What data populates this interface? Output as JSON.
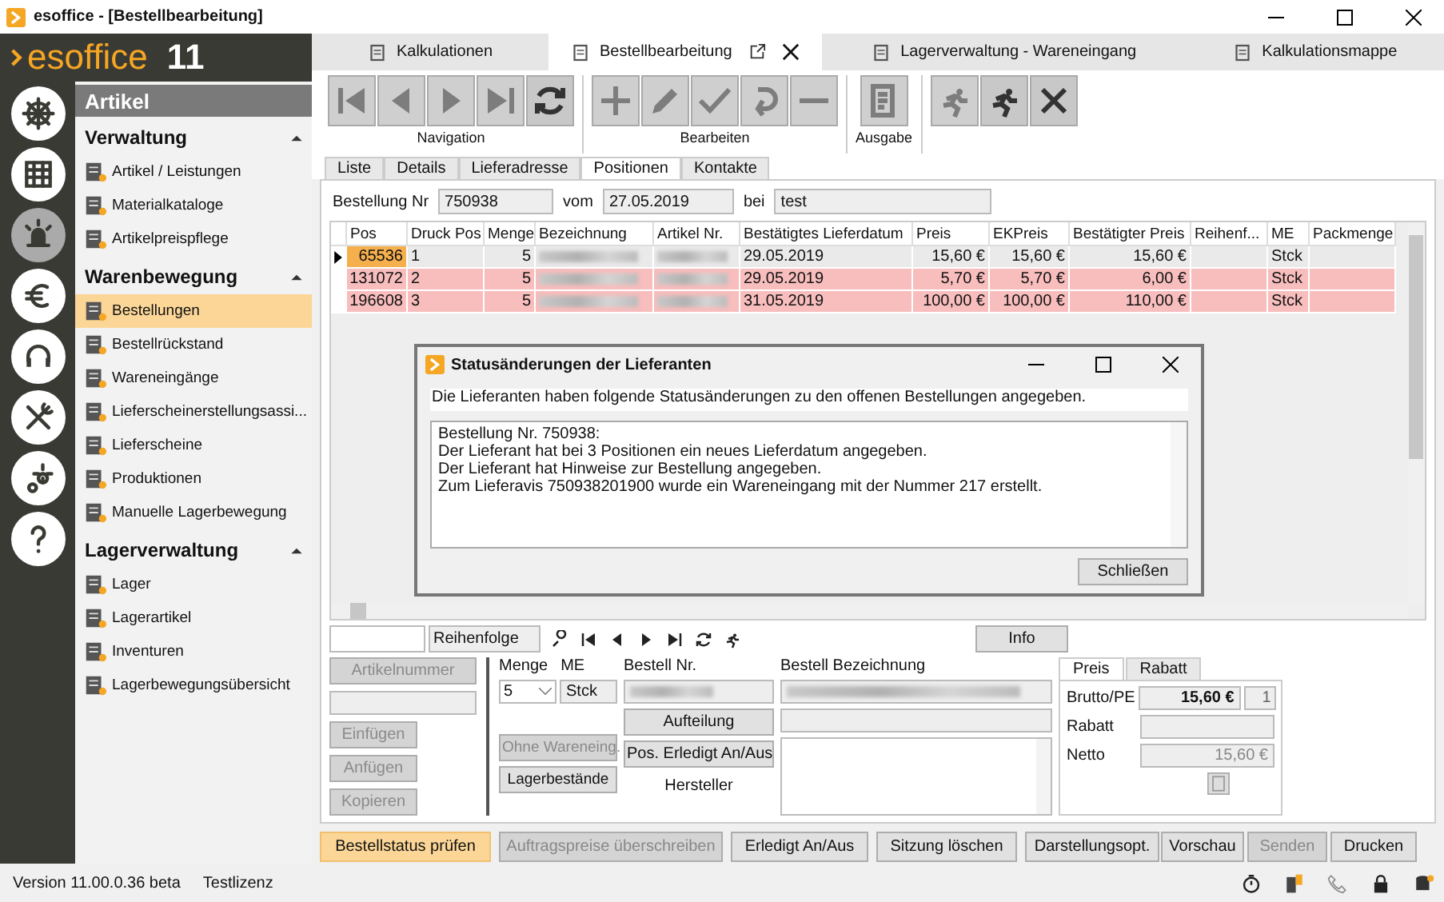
{
  "window": {
    "title": "esoffice - [Bestellbearbeitung]"
  },
  "logo": {
    "name": "esoffice",
    "version": "11"
  },
  "rail": [
    {
      "selected": false
    },
    {
      "selected": false
    },
    {
      "selected": true
    },
    {
      "selected": false
    },
    {
      "selected": false
    },
    {
      "selected": false
    },
    {
      "selected": false
    },
    {
      "selected": false
    }
  ],
  "sidebar": {
    "title": "Artikel",
    "sections": [
      {
        "title": "Verwaltung",
        "expanded": true,
        "items": [
          {
            "label": "Artikel / Leistungen",
            "selected": false
          },
          {
            "label": "Materialkataloge",
            "selected": false
          },
          {
            "label": "Artikelpreispflege",
            "selected": false
          }
        ]
      },
      {
        "title": "Warenbewegung",
        "expanded": true,
        "items": [
          {
            "label": "Bestellungen",
            "selected": true
          },
          {
            "label": "Bestellrückstand",
            "selected": false
          },
          {
            "label": "Wareneingänge",
            "selected": false
          },
          {
            "label": "Lieferscheinerstellungsassi...",
            "selected": false
          },
          {
            "label": "Lieferscheine",
            "selected": false
          },
          {
            "label": "Produktionen",
            "selected": false
          },
          {
            "label": "Manuelle Lagerbewegung",
            "selected": false
          }
        ]
      },
      {
        "title": "Lagerverwaltung",
        "expanded": true,
        "items": [
          {
            "label": "Lager",
            "selected": false
          },
          {
            "label": "Lagerartikel",
            "selected": false
          },
          {
            "label": "Inventuren",
            "selected": false
          },
          {
            "label": "Lagerbewegungsübersicht",
            "selected": false
          }
        ]
      }
    ]
  },
  "tabs": [
    {
      "label": "Kalkulationen",
      "selected": false,
      "closable": false
    },
    {
      "label": "Bestellbearbeitung",
      "selected": true,
      "closable": true
    },
    {
      "label": "Lagerverwaltung - Wareneingang",
      "selected": false,
      "closable": false
    },
    {
      "label": "Kalkulationsmappe",
      "selected": false,
      "closable": false
    }
  ],
  "toolbar": [
    {
      "label": "Navigation",
      "buttons": [
        {
          "kind": "first",
          "disabled": true
        },
        {
          "kind": "prev",
          "disabled": true
        },
        {
          "kind": "next",
          "disabled": true
        },
        {
          "kind": "last",
          "disabled": true
        },
        {
          "kind": "refresh",
          "disabled": false
        }
      ]
    },
    {
      "label": "Bearbeiten",
      "buttons": [
        {
          "kind": "plus",
          "disabled": true
        },
        {
          "kind": "pencil",
          "disabled": true
        },
        {
          "kind": "check",
          "disabled": true
        },
        {
          "kind": "undo",
          "disabled": true
        },
        {
          "kind": "minus",
          "disabled": true
        }
      ]
    },
    {
      "label": "Ausgabe",
      "buttons": [
        {
          "kind": "report",
          "disabled": true
        }
      ]
    },
    {
      "buttons": [
        {
          "kind": "runner",
          "disabled": true
        },
        {
          "kind": "runner",
          "disabled": false
        },
        {
          "kind": "close",
          "disabled": false
        }
      ]
    }
  ],
  "subtabs": [
    {
      "label": "Liste",
      "selected": false
    },
    {
      "label": "Details",
      "selected": false
    },
    {
      "label": "Lieferadresse",
      "selected": false
    },
    {
      "label": "Positionen",
      "selected": true
    },
    {
      "label": "Kontakte",
      "selected": false
    }
  ],
  "header_fields": [
    {
      "label": "Bestellung Nr",
      "value": "750938"
    },
    {
      "label": "vom",
      "value": "27.05.2019"
    },
    {
      "label": "bei",
      "value": "test"
    }
  ],
  "table": {
    "columns": [
      {
        "label": "Pos",
        "numeric": true
      },
      {
        "label": "Druck Pos"
      },
      {
        "label": "Menge",
        "numeric": true
      },
      {
        "label": "Bezeichnung",
        "blurred": true
      },
      {
        "label": "Artikel Nr.",
        "blurred": true
      },
      {
        "label": "Bestätigtes Lieferdatum"
      },
      {
        "label": "Preis",
        "numeric": true
      },
      {
        "label": "EKPreis",
        "numeric": true
      },
      {
        "label": "Bestätigter Preis",
        "numeric": true
      },
      {
        "label": "Reihenf...",
        "filter": true
      },
      {
        "label": "ME"
      },
      {
        "label": "Packmenge"
      }
    ],
    "rows": [
      {
        "selected": true,
        "flagged": false,
        "cells": [
          "65536",
          "1",
          "5",
          null,
          null,
          "29.05.2019",
          "15,60 €",
          "15,60 €",
          "15,60 €",
          null,
          "Stck",
          null
        ]
      },
      {
        "selected": false,
        "flagged": true,
        "cells": [
          "131072",
          "2",
          "5",
          null,
          null,
          "29.05.2019",
          "5,70 €",
          "5,70 €",
          "6,00 €",
          null,
          "Stck",
          null
        ]
      },
      {
        "selected": false,
        "flagged": true,
        "cells": [
          "196608",
          "3",
          "5",
          null,
          null,
          "31.05.2019",
          "100,00 €",
          "100,00 €",
          "110,00 €",
          null,
          "Stck",
          null
        ]
      }
    ]
  },
  "dialog": {
    "title": "Statusänderungen der Lieferanten",
    "intro": "Die Lieferanten haben folgende Statusänderungen zu den offenen Bestellungen angegeben.",
    "lines": [
      "Bestellung Nr. 750938:",
      "Der Lieferant hat bei 3 Positionen ein neues Lieferdatum angegeben.",
      "Der Lieferant hat Hinweise zur Bestellung angegeben.",
      "Zum Lieferavis 750938201900 wurde ein Wareneingang mit der Nummer 217 erstellt."
    ],
    "button": "Schließen"
  },
  "navbar": {
    "sort_value": "Reihenfolge",
    "info_button": "Info"
  },
  "detail": {
    "left_buttons": [
      {
        "label": "Artikelnummer",
        "disabled": true
      },
      {
        "label": "Einfügen",
        "disabled": true
      },
      {
        "label": "Anfügen",
        "disabled": true
      },
      {
        "label": "Kopieren",
        "disabled": true
      }
    ],
    "menge": {
      "label": "Menge",
      "value": "5"
    },
    "me": {
      "label": "ME",
      "value": "Stck"
    },
    "ohne_button": {
      "label": "Ohne Wareneing.",
      "disabled": true
    },
    "lager_button": {
      "label": "Lagerbestände",
      "disabled": false
    },
    "bestell_nr": {
      "label": "Bestell Nr.",
      "blurred": true
    },
    "aufteilung_button": "Aufteilung",
    "pos_button": "Pos. Erledigt An/Aus",
    "hersteller": "Hersteller",
    "bezeichnung": {
      "label": "Bestell Bezeichnung",
      "blurred": true
    }
  },
  "price": {
    "tabs": [
      {
        "label": "Preis",
        "selected": true
      },
      {
        "label": "Rabatt",
        "selected": false
      }
    ],
    "brutto_label": "Brutto/PE",
    "brutto": "15,60 €",
    "pe": "1",
    "rabatt_label": "Rabatt",
    "netto_label": "Netto",
    "netto": "15,60 €"
  },
  "actions": [
    {
      "label": "Bestellstatus prüfen",
      "highlighted": true,
      "disabled": false
    },
    {
      "label": "Auftragspreise überschreiben",
      "highlighted": false,
      "disabled": true
    },
    {
      "label": "Erledigt An/Aus",
      "highlighted": false,
      "disabled": false
    },
    {
      "label": "Sitzung löschen",
      "highlighted": false,
      "disabled": false
    },
    {
      "label": "Darstellungsopt.",
      "highlighted": false,
      "disabled": false
    },
    {
      "label": "Vorschau",
      "highlighted": false,
      "disabled": false
    },
    {
      "label": "Senden",
      "highlighted": false,
      "disabled": true
    },
    {
      "label": "Drucken",
      "highlighted": false,
      "disabled": false
    }
  ],
  "status_bar": {
    "version": "Version 11.00.0.36 beta",
    "license": "Testlizenz"
  }
}
